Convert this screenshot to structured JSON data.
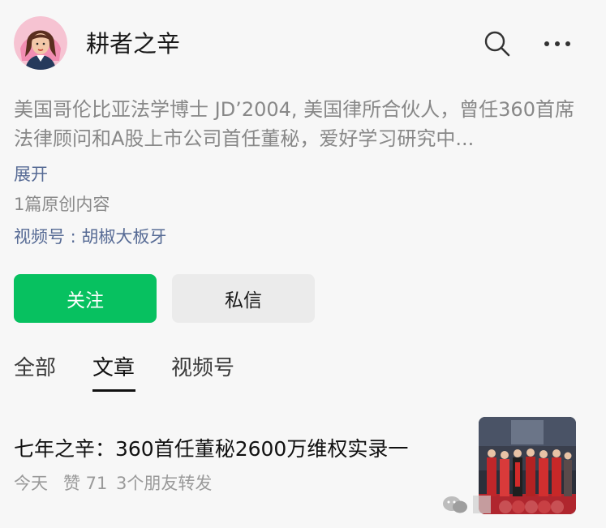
{
  "account": {
    "name": "耕者之辛",
    "bio": "美国哥伦比亚法学博士 JD’2004, 美国律所合伙人，曾任360首席法律顾问和A股上市公司首任董秘，爱好学习研究中...",
    "expand_label": "展开",
    "original_count": "1篇原创内容",
    "channel_link": "视频号 : 胡椒大板牙"
  },
  "actions": {
    "follow_label": "关注",
    "message_label": "私信"
  },
  "tabs": [
    {
      "label": "全部",
      "active": false
    },
    {
      "label": "文章",
      "active": true
    },
    {
      "label": "视频号",
      "active": false
    }
  ],
  "articles": [
    {
      "title": "七年之辛：360首任董秘2600万维权实录一",
      "date": "今天",
      "likes": "赞 71",
      "shares": "3个朋友转发"
    }
  ],
  "colors": {
    "accent": "#07c160",
    "link": "#576b95",
    "background": "#f7f7f7"
  },
  "icons": {
    "search": "search-icon",
    "more": "more-icon"
  }
}
